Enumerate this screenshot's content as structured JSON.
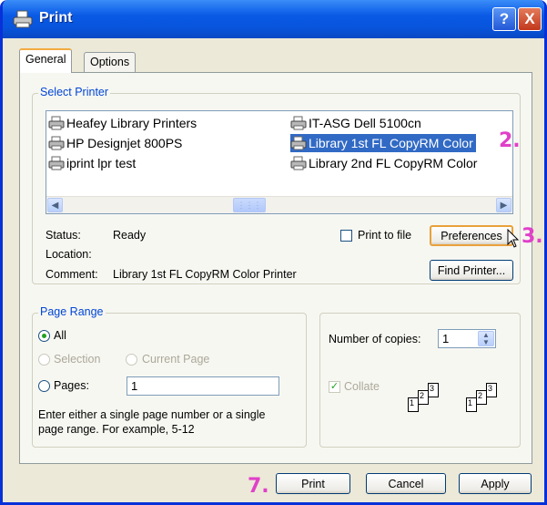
{
  "window": {
    "title": "Print",
    "help_label": "?",
    "close_label": "X"
  },
  "tabs": [
    "General",
    "Options"
  ],
  "select_printer": {
    "legend": "Select Printer",
    "printers_left": [
      "Heafey Library Printers",
      "HP Designjet 800PS",
      "iprint lpr test"
    ],
    "printers_right": [
      "IT-ASG Dell 5100cn",
      "Library 1st FL CopyRM Color",
      "Library 2nd FL CopyRM Color"
    ],
    "selected": "Library 1st FL CopyRM Color",
    "status_label": "Status:",
    "status_value": "Ready",
    "location_label": "Location:",
    "location_value": "",
    "comment_label": "Comment:",
    "comment_value": "Library 1st FL CopyRM Color Printer",
    "print_to_file_label": "Print to file",
    "print_to_file_checked": false,
    "preferences_label": "Preferences",
    "find_printer_label": "Find Printer..."
  },
  "page_range": {
    "legend": "Page Range",
    "all_label": "All",
    "selection_label": "Selection",
    "current_page_label": "Current Page",
    "pages_label": "Pages:",
    "pages_value": "1",
    "selected_option": "All",
    "help_text_line1": "Enter either a single page number or a single",
    "help_text_line2": "page range.  For example, 5-12"
  },
  "copies": {
    "label": "Number of copies:",
    "value": "1",
    "collate_label": "Collate",
    "collate_checked": true,
    "collate_pages": [
      "1",
      "2",
      "3"
    ]
  },
  "buttons": {
    "print": "Print",
    "cancel": "Cancel",
    "apply": "Apply"
  },
  "annotations": {
    "step2": "2.",
    "step3": "3.",
    "step7": "7."
  },
  "colors": {
    "titlebar": "#0A5AE6",
    "selection": "#316AC5",
    "annotation": "#E040C8",
    "group_legend": "#0046D5"
  }
}
